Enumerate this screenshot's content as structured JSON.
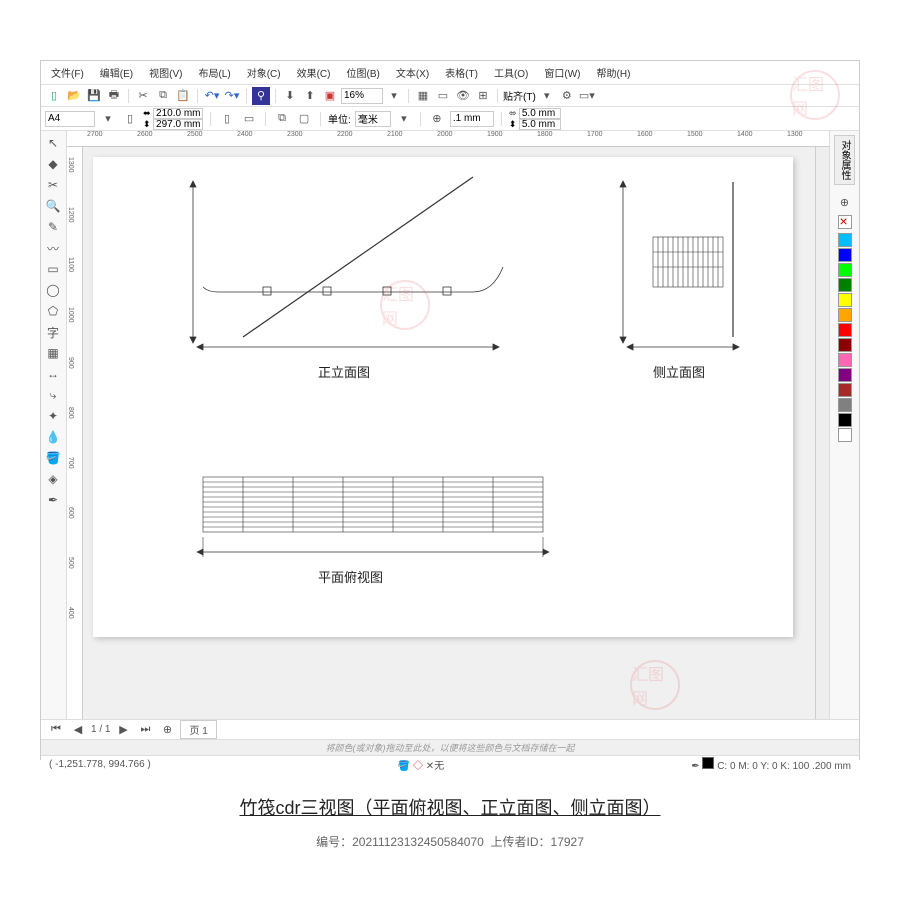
{
  "menu": {
    "items": [
      "文件(F)",
      "编辑(E)",
      "视图(V)",
      "布局(L)",
      "对象(C)",
      "效果(C)",
      "位图(B)",
      "文本(X)",
      "表格(T)",
      "工具(O)",
      "窗口(W)",
      "帮助(H)"
    ]
  },
  "toolbar1": {
    "zoom": "16%",
    "align_label": "贴齐(T)"
  },
  "propbar": {
    "page_size": "A4",
    "width": "210.0 mm",
    "height": "297.0 mm",
    "units_label": "单位:",
    "units_value": "毫米",
    "nudge": ".1 mm",
    "dupe_x": "5.0 mm",
    "dupe_y": "5.0 mm"
  },
  "ruler_h": [
    "2700",
    "2600",
    "2500",
    "2400",
    "2300",
    "2200",
    "2100",
    "2000",
    "1900",
    "1800",
    "1700",
    "1600",
    "1500",
    "1400",
    "1300"
  ],
  "ruler_v": [
    "1300",
    "1200",
    "1100",
    "1000",
    "900",
    "800",
    "700",
    "600",
    "500",
    "400"
  ],
  "views": {
    "front": "正立面图",
    "side": "侧立面图",
    "top": "平面俯视图"
  },
  "dock": {
    "tab": "对象属性"
  },
  "swatches": [
    "#00bfff",
    "#0000ff",
    "#00ff00",
    "#008000",
    "#ffff00",
    "#ffa500",
    "#ff0000",
    "#8b0000",
    "#ff69b4",
    "#800080",
    "#a52a2a",
    "#808080",
    "#000000",
    "#ffffff"
  ],
  "pagebar": {
    "nav": "1 / 1",
    "tab": "页 1"
  },
  "hint": "将颜色(或对象)拖动至此处，以便将这些颜色与文档存储在一起",
  "status": {
    "cursor": "( -1,251.778, 994.766 )",
    "fill_none": "无",
    "right": "C: 0 M: 0 Y: 0 K: 100  .200 mm"
  },
  "caption": "竹筏cdr三视图（平面俯视图、正立面图、侧立面图）",
  "meta": {
    "id_label": "编号：",
    "id": "20211123132450584070",
    "uploader_label": "上传者ID：",
    "uploader": "17927"
  }
}
